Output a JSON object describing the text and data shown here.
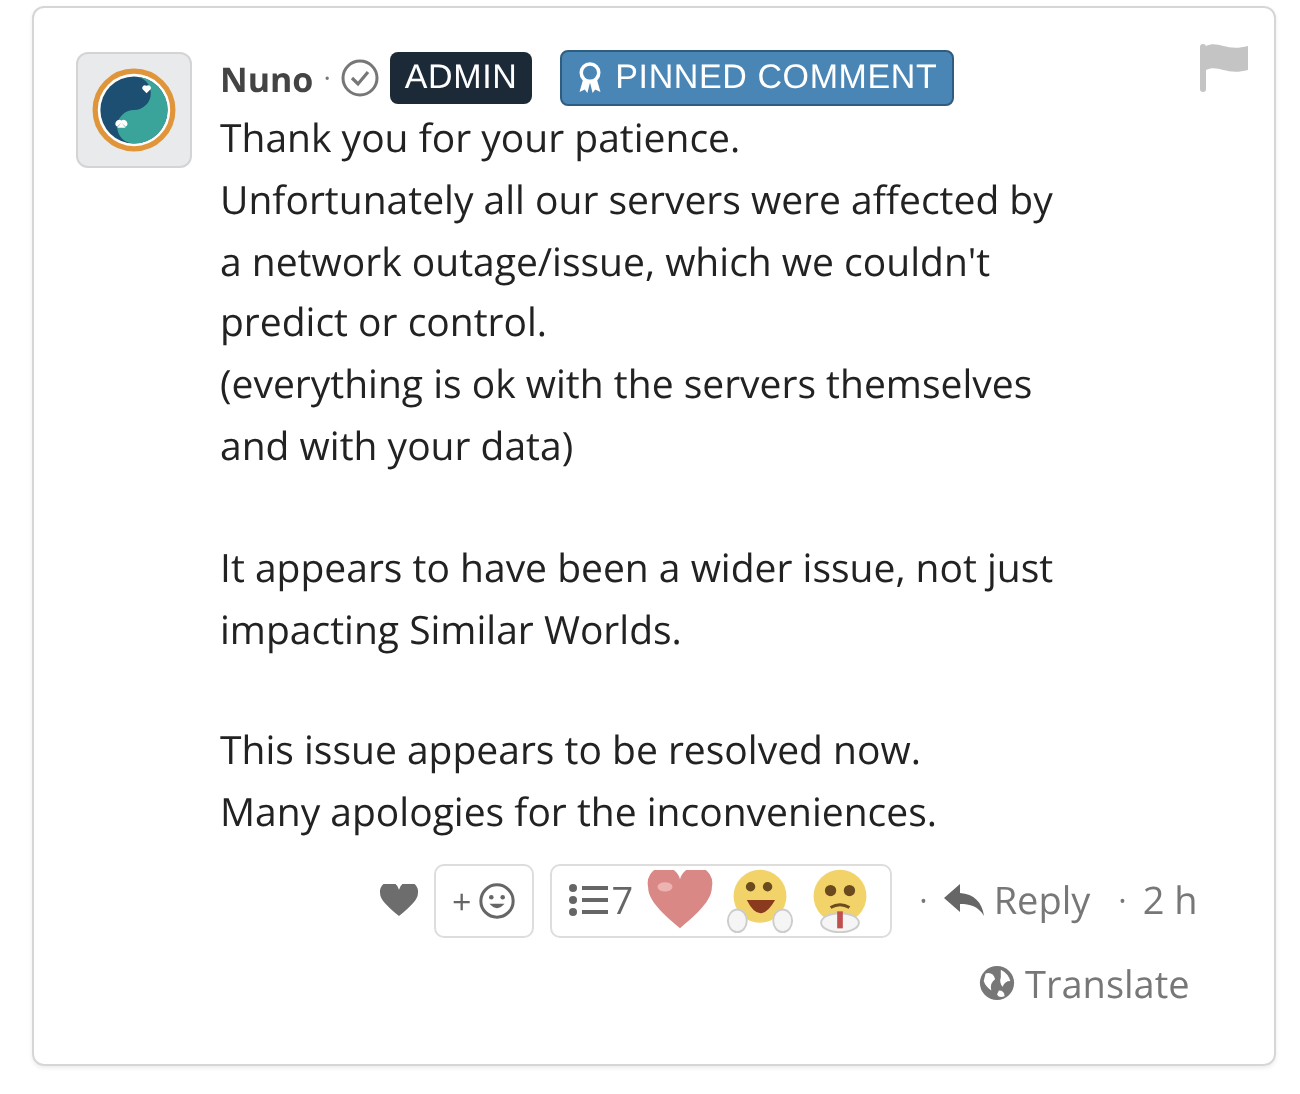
{
  "comment": {
    "author": "Nuno",
    "separator": "·",
    "verified": true,
    "badges": [
      {
        "kind": "role",
        "label": "ADMIN"
      },
      {
        "kind": "pinned",
        "label": "PINNED COMMENT"
      }
    ],
    "paragraphs": [
      [
        "Thank you for your patience.",
        "Unfortunately all our servers were affected by",
        "a network outage/issue, which we couldn't",
        "predict or control.",
        "(everything is ok with the servers themselves",
        "and with your data)"
      ],
      [
        "It appears to have been a wider issue, not just",
        "impacting Similar Worlds."
      ],
      [
        "This issue appears to be resolved now.",
        "Many apologies for the inconveniences."
      ]
    ],
    "add_reaction": "+",
    "reactions": {
      "count": "7",
      "emojis": [
        {
          "kind": "heart"
        },
        {
          "kind": "laugh"
        },
        {
          "kind": "pleading"
        }
      ]
    },
    "dot": "·",
    "reply": "Reply",
    "reply_dot": "·",
    "time": "2 h",
    "translate": "Translate"
  }
}
